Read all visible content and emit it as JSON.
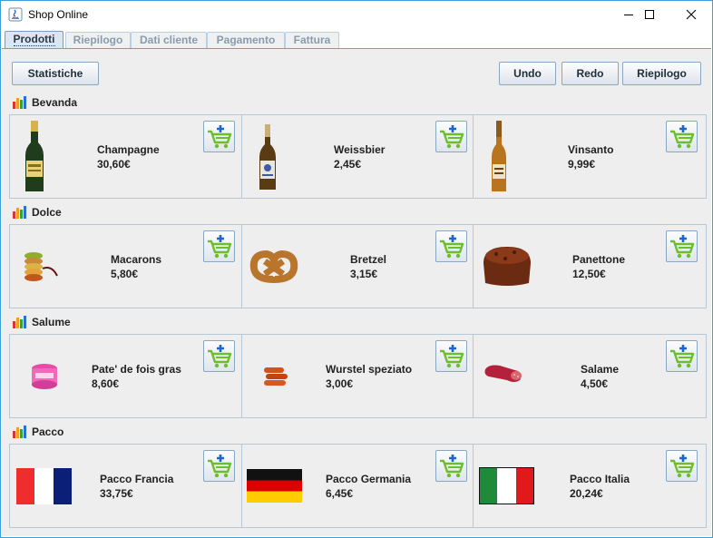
{
  "window": {
    "title": "Shop Online"
  },
  "tabs": [
    {
      "label": "Prodotti",
      "active": true
    },
    {
      "label": "Riepilogo",
      "active": false
    },
    {
      "label": "Dati cliente",
      "active": false
    },
    {
      "label": "Pagamento",
      "active": false
    },
    {
      "label": "Fattura",
      "active": false
    }
  ],
  "toolbar": {
    "stats_label": "Statistiche",
    "undo_label": "Undo",
    "redo_label": "Redo",
    "summary_label": "Riepilogo"
  },
  "categories": [
    {
      "name": "Bevanda",
      "products": [
        {
          "name": "Champagne",
          "price": "30,60€",
          "image": "champagne-bottle"
        },
        {
          "name": "Weissbier",
          "price": "2,45€",
          "image": "beer-bottle"
        },
        {
          "name": "Vinsanto",
          "price": "9,99€",
          "image": "wine-bottle"
        }
      ]
    },
    {
      "name": "Dolce",
      "products": [
        {
          "name": "Macarons",
          "price": "5,80€",
          "image": "macarons"
        },
        {
          "name": "Bretzel",
          "price": "3,15€",
          "image": "pretzel"
        },
        {
          "name": "Panettone",
          "price": "12,50€",
          "image": "panettone"
        }
      ]
    },
    {
      "name": "Salume",
      "products": [
        {
          "name": "Pate' de fois gras",
          "price": "8,60€",
          "image": "pate-jar"
        },
        {
          "name": "Wurstel speziato",
          "price": "3,00€",
          "image": "sausages"
        },
        {
          "name": "Salame",
          "price": "4,50€",
          "image": "salami"
        }
      ]
    },
    {
      "name": "Pacco",
      "products": [
        {
          "name": "Pacco Francia",
          "price": "33,75€",
          "image": "flag-france"
        },
        {
          "name": "Pacco Germania",
          "price": "6,45€",
          "image": "flag-germany"
        },
        {
          "name": "Pacco Italia",
          "price": "20,24€",
          "image": "flag-italy"
        }
      ]
    }
  ],
  "colors": {
    "accent_border": "#3c9fd6",
    "cart_green": "#6cbf2a",
    "cart_plus": "#1b66c9"
  }
}
